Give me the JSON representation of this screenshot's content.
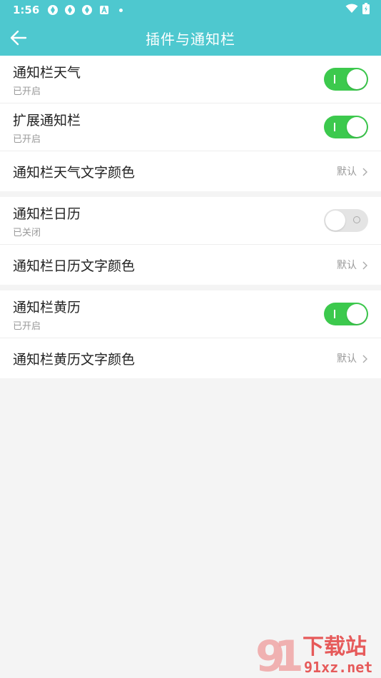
{
  "status": {
    "time": "1:56"
  },
  "appbar": {
    "title": "插件与通知栏"
  },
  "groups": [
    {
      "items": [
        {
          "label": "通知栏天气",
          "sub": "已开启",
          "on": true
        },
        {
          "label": "扩展通知栏",
          "sub": "已开启",
          "on": true
        },
        {
          "label": "通知栏天气文字颜色",
          "value": "默认"
        }
      ]
    },
    {
      "items": [
        {
          "label": "通知栏日历",
          "sub": "已关闭",
          "on": false
        },
        {
          "label": "通知栏日历文字颜色",
          "value": "默认"
        }
      ]
    },
    {
      "items": [
        {
          "label": "通知栏黄历",
          "sub": "已开启",
          "on": true
        },
        {
          "label": "通知栏黄历文字颜色",
          "value": "默认"
        }
      ]
    }
  ],
  "watermark": {
    "text_top": "下载站",
    "text_bottom": "91xz.net"
  },
  "colors": {
    "header": "#4ec8cf",
    "toggle_on": "#3cc94d",
    "toggle_off": "#e4e4e4"
  }
}
